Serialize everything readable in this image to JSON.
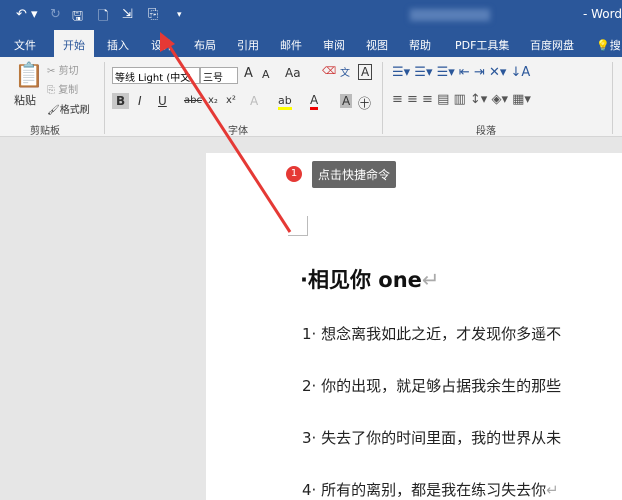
{
  "titlebar": {
    "undo": "↶ ▾",
    "redo": "↻",
    "save": "🖫",
    "preview": "🗋",
    "touch": "⇲",
    "custom": "⎘",
    "more": "▾",
    "title": "- Word"
  },
  "tabs": [
    "文件",
    "开始",
    "插入",
    "设计",
    "布局",
    "引用",
    "邮件",
    "审阅",
    "视图",
    "帮助",
    "PDF工具集",
    "百度网盘"
  ],
  "tell": "搜",
  "clipboard": {
    "paste": "粘贴",
    "cut": "剪切",
    "copy": "复制",
    "format_painter": "格式刷",
    "group": "剪贴板"
  },
  "font": {
    "name": "等线 Light (中文",
    "size": "三号",
    "group": "字体",
    "grow": "A",
    "shrink": "A",
    "case": "Aa",
    "bold": "B",
    "italic": "I",
    "underline": "U",
    "strike": "abc",
    "sub": "x₂",
    "sup": "x²"
  },
  "paragraph": {
    "group": "段落"
  },
  "tooltip": {
    "number": "1",
    "text": "点击快捷命令"
  },
  "document": {
    "heading": "·相见你 one",
    "lines": [
      "1· 想念离我如此之近，才发现你多遥不",
      "2· 你的出现，就足够占据我余生的那些",
      "3· 失去了你的时间里面，我的世界从未",
      "4· 所有的离别，都是我在练习失去你"
    ]
  },
  "colors": {
    "brand": "#2b579a",
    "arrow": "#e53935"
  }
}
